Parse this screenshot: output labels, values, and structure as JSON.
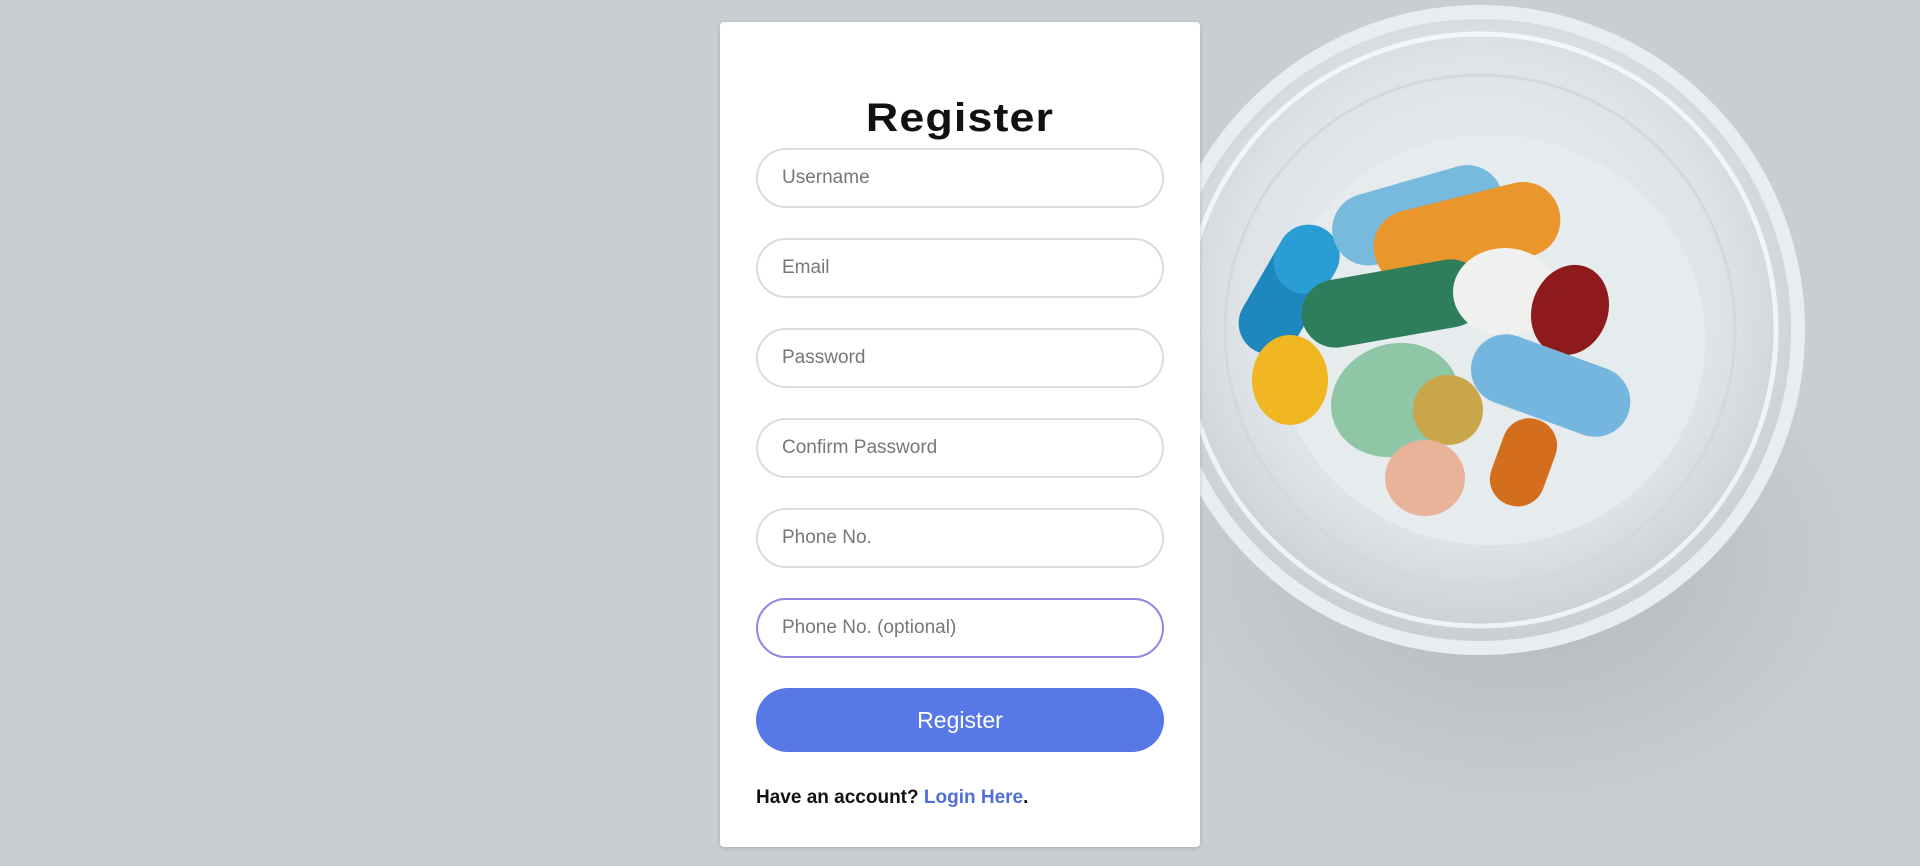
{
  "form": {
    "title": "Register",
    "fields": {
      "username": {
        "placeholder": "Username",
        "value": ""
      },
      "email": {
        "placeholder": "Email",
        "value": ""
      },
      "password": {
        "placeholder": "Password",
        "value": ""
      },
      "confirm_password": {
        "placeholder": "Confirm Password",
        "value": ""
      },
      "phone": {
        "placeholder": "Phone No.",
        "value": ""
      },
      "phone_optional": {
        "placeholder": "Phone No. (optional)",
        "value": ""
      }
    },
    "submit_label": "Register",
    "footer": {
      "prompt": "Have an account?",
      "link_label": "Login Here",
      "trailing": "."
    }
  },
  "colors": {
    "background": "#c9ced1",
    "card": "#ffffff",
    "button": "#5978e8",
    "link": "#4f6fd6",
    "focus_border": "#8f86e6"
  },
  "background_image": {
    "icon": "pills-in-glass-bowl-photo"
  }
}
